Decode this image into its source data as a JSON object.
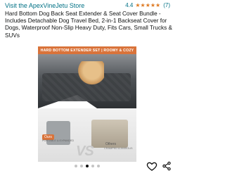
{
  "store": {
    "link_text": "Visit the ApexVineJetu Store"
  },
  "rating": {
    "value": "4.4",
    "count": "(7)",
    "stars": 4.4
  },
  "product": {
    "title": "Hard Bottom Dog Back Seat Extender & Seat Cover Bundle - Includes Detachable Dog Travel Bed, 2-in-1 Backseat Cover for Dogs, Waterproof Non-Slip Heavy Duty, Fits Cars, Small Trucks & SUVs"
  },
  "image": {
    "banner": "HARD BOTTOM EXTENDER SET  |  ROOMY & COZY",
    "vs": "VS",
    "ours_tag": "Ours",
    "ours_sub": "PORTABLE & EXPANDED",
    "others_tag": "Others",
    "others_sub": "CRAMPED & ANXIOUS"
  },
  "carousel": {
    "total": 5,
    "active_index": 2
  },
  "colors": {
    "link": "#007185",
    "star": "#de7921",
    "banner": "#d9733a"
  }
}
